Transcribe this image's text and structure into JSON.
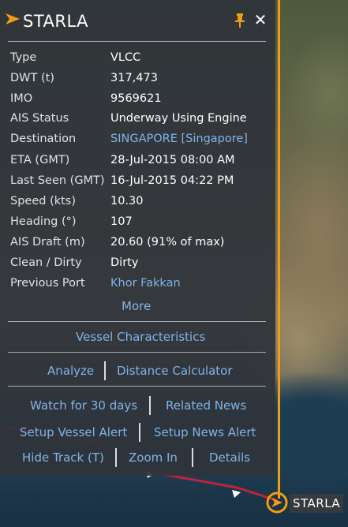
{
  "vessel": {
    "name": "STARLA",
    "fields": [
      {
        "label": "Type",
        "value": "VLCC",
        "link": false
      },
      {
        "label": "DWT (t)",
        "value": "317,473",
        "link": false
      },
      {
        "label": "IMO",
        "value": "9569621",
        "link": false
      },
      {
        "label": "AIS Status",
        "value": "Underway Using Engine",
        "link": false
      },
      {
        "label": "Destination",
        "value": "SINGAPORE [Singapore]",
        "link": true
      },
      {
        "label": "ETA (GMT)",
        "value": "28-Jul-2015 08:00 AM",
        "link": false
      },
      {
        "label": "Last Seen (GMT)",
        "value": "16-Jul-2015 04:22 PM",
        "link": false
      },
      {
        "label": "Speed (kts)",
        "value": "10.30",
        "link": false
      },
      {
        "label": "Heading (°)",
        "value": "107",
        "link": false
      },
      {
        "label": "AIS Draft (m)",
        "value": "20.60  (91% of max)",
        "link": false
      },
      {
        "label": "Clean / Dirty",
        "value": "Dirty",
        "link": false
      },
      {
        "label": "Previous Port",
        "value": "Khor Fakkan",
        "link": true
      }
    ]
  },
  "actions": {
    "more": "More",
    "vessel_characteristics": "Vessel Characteristics",
    "analyze": "Analyze",
    "distance_calculator": "Distance Calculator",
    "watch": "Watch for 30 days",
    "related_news": "Related News",
    "setup_vessel_alert": "Setup Vessel Alert",
    "setup_news_alert": "Setup News Alert",
    "hide_track": "Hide Track (T)",
    "zoom_in": "Zoom In",
    "details": "Details"
  },
  "map_label": "STARLA",
  "colors": {
    "accent": "#f39c12",
    "link": "#7fb4ea",
    "panel_bg": "#2f343a",
    "track": "#d0213a"
  },
  "icons": {
    "title": "orange-arrow-icon",
    "pin": "pin-icon",
    "close": "close-icon",
    "ship": "ship-marker-icon"
  }
}
